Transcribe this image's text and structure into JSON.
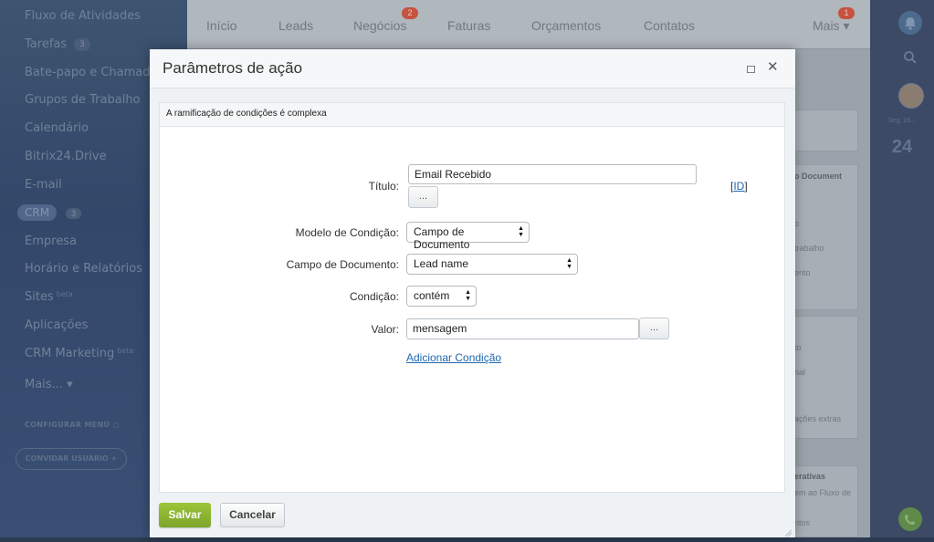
{
  "sidebar": {
    "items": [
      {
        "label": "Fluxo de Atividades"
      },
      {
        "label": "Tarefas",
        "count": "3"
      },
      {
        "label": "Bate-papo e Chamadas"
      },
      {
        "label": "Grupos de Trabalho"
      },
      {
        "label": "Calendário"
      },
      {
        "label": "Bitrix24.Drive"
      },
      {
        "label": "E-mail"
      },
      {
        "label": "CRM",
        "count": "3"
      },
      {
        "label": "Empresa"
      },
      {
        "label": "Horário e Relatórios"
      },
      {
        "label": "Sites",
        "tag": "beta"
      },
      {
        "label": "Aplicações"
      },
      {
        "label": "CRM Marketing",
        "tag": "beta"
      },
      {
        "label": "Mais... ▾"
      }
    ],
    "configure_menu": "CONFIGURAR MENU",
    "invite_user": "CONVIDAR USUÁRIO  +"
  },
  "topnav": {
    "items": [
      "Início",
      "Leads",
      "Negócios",
      "Faturas",
      "Orçamentos",
      "Contatos"
    ],
    "negocios_badge": "2",
    "more_label": "Mais ▾",
    "more_badge": "1"
  },
  "background_panel": {
    "panel1_title": "o Document",
    "panel1_lines": [
      "o",
      "trabalho",
      "ento"
    ],
    "panel2_lines": [
      "to",
      "nal",
      "ações extras"
    ],
    "panel3_title": "erativas",
    "panel3_lines": [
      "em ao Fluxo de",
      "ntos"
    ]
  },
  "right_rail": {
    "date_label": "Seg, 16...",
    "day_number": "24"
  },
  "dialog": {
    "title": "Parâmetros de ação",
    "subheader": "A ramificação de condições é complexa",
    "fields": {
      "title_label": "Título:",
      "title_value": "Email Recebido",
      "id_link": "[ID]",
      "model_label": "Modelo de Condição:",
      "model_value": "Campo de Documento",
      "doc_field_label": "Campo de Documento:",
      "doc_field_value": "Lead name",
      "condition_label": "Condição:",
      "condition_value": "contém",
      "value_label": "Valor:",
      "value_value": "mensagem",
      "dots_label": "...",
      "add_condition": "Adicionar Condição"
    },
    "buttons": {
      "save": "Salvar",
      "cancel": "Cancelar"
    }
  }
}
